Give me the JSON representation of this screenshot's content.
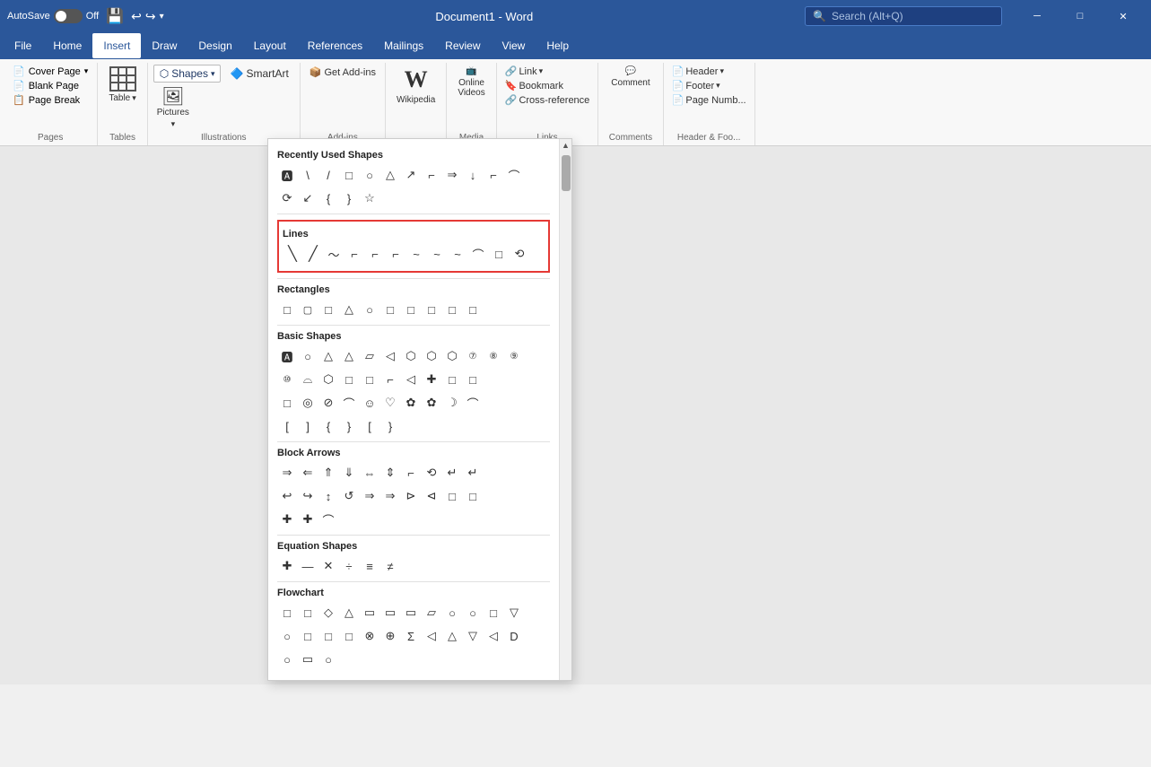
{
  "titleBar": {
    "autosave": "AutoSave",
    "autosave_state": "Off",
    "title": "Document1 - Word",
    "search_placeholder": "Search (Alt+Q)"
  },
  "menuBar": {
    "items": [
      "File",
      "Home",
      "Insert",
      "Draw",
      "Design",
      "Layout",
      "References",
      "Mailings",
      "Review",
      "View",
      "Help"
    ],
    "active": "Insert"
  },
  "ribbon": {
    "pages_group": "Pages",
    "tables_group": "Tables",
    "illustrations_group": "Illustrations",
    "addins_group": "Add-ins",
    "media_group": "Media",
    "links_group": "Links",
    "comments_group": "Comments",
    "header_footer_group": "Header & Foo...",
    "cover_page": "Cover Page",
    "blank_page": "Blank Page",
    "page_break": "Page Break",
    "table_label": "Table",
    "shapes_label": "Shapes",
    "smartart_label": "SmartArt",
    "get_addins_label": "Get Add-ins",
    "wikipedia_label": "Wikipedia",
    "online_videos_label": "Online\nVideos",
    "link_label": "Link",
    "bookmark_label": "Bookmark",
    "cross_ref_label": "Cross-reference",
    "comment_label": "Comment",
    "header_label": "Header",
    "footer_label": "Footer",
    "page_number_label": "Page Numb..."
  },
  "shapesPanel": {
    "recently_used_title": "Recently Used Shapes",
    "recently_used_shapes": [
      "🅰",
      "\\",
      "/",
      "□",
      "○",
      "△",
      "↗",
      "⌐",
      "⇒",
      "↓",
      "⌐",
      "⟳",
      "↙",
      "{",
      "}",
      "☆"
    ],
    "lines_title": "Lines",
    "lines_shapes": [
      "\\",
      "/",
      "~",
      "⌐",
      "⌐",
      "⌐",
      "~",
      "~",
      "~",
      "⌒",
      "□",
      "⟲"
    ],
    "rectangles_title": "Rectangles",
    "rectangles_shapes": [
      "□",
      "□",
      "□",
      "△",
      "○",
      "□",
      "□",
      "□",
      "□",
      "□"
    ],
    "basic_shapes_title": "Basic Shapes",
    "basic_shapes_row1": [
      "🅰",
      "○",
      "△",
      "△",
      "▱",
      "△",
      "⬡",
      "⬡",
      "⬡",
      "⑦",
      "⑧",
      "⑨"
    ],
    "basic_shapes_row2": [
      "⑩",
      "⌓",
      "⬡",
      "□",
      "□",
      "⌐",
      "◁",
      "✚",
      "□",
      "□",
      "□"
    ],
    "basic_shapes_row3": [
      "□",
      "◎",
      "⊘",
      "⌒",
      "☺",
      "❤",
      "✿",
      "☽",
      "C",
      "⌒"
    ],
    "basic_shapes_row4": [
      "[",
      "]",
      "{",
      "}",
      "[",
      "}"
    ],
    "block_arrows_title": "Block Arrows",
    "block_arrows_row1": [
      "⇒",
      "⇐",
      "⇑",
      "⇓",
      "⇔",
      "⇕",
      "⌐",
      "⟲",
      "↵",
      "↵"
    ],
    "block_arrows_row2": [
      "↩",
      "↪",
      "↕",
      "↺",
      "⇒",
      "⇒",
      "⊳",
      "⊲",
      "□",
      "□"
    ],
    "block_arrows_row3": [
      "✚",
      "✚",
      "⌒"
    ],
    "equation_shapes_title": "Equation Shapes",
    "equation_shapes": [
      "✚",
      "—",
      "✕",
      "÷",
      "≡",
      "≠"
    ],
    "flowchart_title": "Flowchart",
    "flowchart_row1": [
      "□",
      "□",
      "◇",
      "△",
      "▭",
      "▭",
      "▭",
      "▱",
      "○",
      "○",
      "□",
      "▽"
    ],
    "flowchart_row2": [
      "○",
      "□",
      "□",
      "□",
      "⊗",
      "⊕",
      "Σ",
      "◁",
      "△",
      "▽",
      "◁",
      "D"
    ],
    "flowchart_row3": [
      "○",
      "▭",
      "○"
    ]
  }
}
